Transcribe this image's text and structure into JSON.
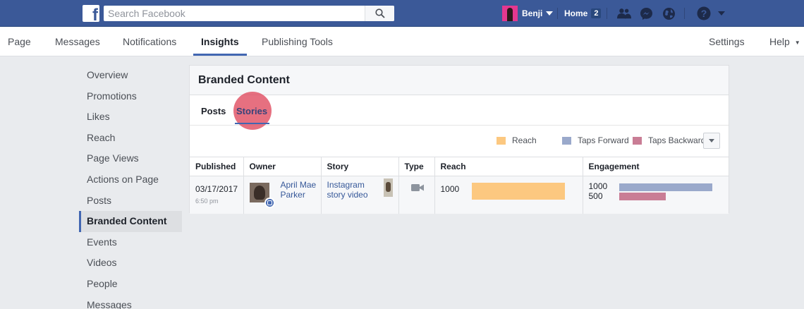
{
  "topbar": {
    "search_placeholder": "Search Facebook",
    "user_name": "Benji",
    "home_label": "Home",
    "home_count": "2",
    "icons": [
      "friend-requests-icon",
      "messenger-icon",
      "globe-icon",
      "help-icon"
    ]
  },
  "pagenav": {
    "items": [
      "Page",
      "Messages",
      "Notifications",
      "Insights",
      "Publishing Tools"
    ],
    "active": "Insights",
    "settings": "Settings",
    "help": "Help"
  },
  "sidebar": {
    "items": [
      "Overview",
      "Promotions",
      "Likes",
      "Reach",
      "Page Views",
      "Actions on Page",
      "Posts",
      "Branded Content",
      "Events",
      "Videos",
      "People",
      "Messages"
    ],
    "active": "Branded Content"
  },
  "panel": {
    "title": "Branded Content",
    "tabs": [
      "Posts",
      "Stories"
    ],
    "active_tab": "Stories",
    "legend": [
      {
        "label": "Reach",
        "color": "#fcc880"
      },
      {
        "label": "Taps Forward",
        "color": "#9aa9cb"
      },
      {
        "label": "Taps Backward",
        "color": "#c97d95"
      }
    ],
    "columns": [
      "Published",
      "Owner",
      "Story",
      "Type",
      "Reach",
      "Engagement"
    ],
    "rows": [
      {
        "published_date": "03/17/2017",
        "published_time": "6:50 pm",
        "owner": "April Mae Parker",
        "story": "Instagram story video",
        "type_icon": "video-camera-icon",
        "reach": "1000",
        "reach_fraction": 1.0,
        "engagement_forward": "1000",
        "engagement_backward": "500",
        "forward_fraction": 1.0,
        "backward_fraction": 0.5
      }
    ]
  }
}
